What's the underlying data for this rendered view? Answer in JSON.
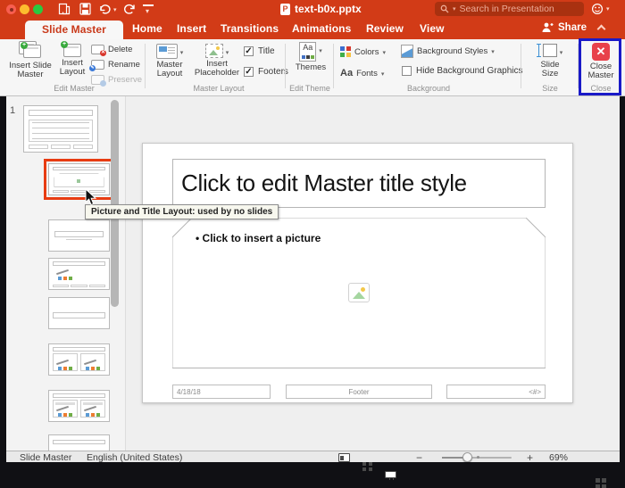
{
  "titlebar": {
    "title": "text-b0x.pptx",
    "search_placeholder": "Search in Presentation"
  },
  "tabs": {
    "items": [
      {
        "label": "Slide Master"
      },
      {
        "label": "Home"
      },
      {
        "label": "Insert"
      },
      {
        "label": "Transitions"
      },
      {
        "label": "Animations"
      },
      {
        "label": "Review"
      },
      {
        "label": "View"
      }
    ],
    "share_label": "Share"
  },
  "ribbon": {
    "insert_slide_master": "Insert Slide Master",
    "insert_layout": "Insert Layout",
    "delete": "Delete",
    "rename": "Rename",
    "preserve": "Preserve",
    "group_edit_master": "Edit Master",
    "master_layout": "Master Layout",
    "insert_placeholder": "Insert Placeholder",
    "title_checkbox": "Title",
    "footers_checkbox": "Footers",
    "checkmark": "✓",
    "group_master_layout": "Master Layout",
    "themes": "Themes",
    "group_edit_theme": "Edit Theme",
    "colors": "Colors",
    "fonts": "Fonts",
    "fonts_aa": "Aa",
    "themes_aa": "Aa",
    "background_styles": "Background Styles",
    "hide_background_graphics": "Hide Background Graphics",
    "group_background": "Background",
    "slide_size": "Slide Size",
    "group_size": "Size",
    "close_master": "Close Master",
    "close_x": "✕",
    "group_close": "Close",
    "highlight_color": "#1a1ac8"
  },
  "sidebar": {
    "index": "1",
    "tooltip": "Picture and Title Layout: used by no slides",
    "selected_border_color": "#e83c12",
    "thumbnails": [
      {
        "kind": "master",
        "name": "master-slide-thumbnail",
        "selected": false
      },
      {
        "kind": "picture",
        "name": "picture-and-title-layout-thumbnail",
        "selected": true
      },
      {
        "kind": "title",
        "name": "title-slide-layout-thumbnail",
        "selected": false
      },
      {
        "kind": "content",
        "name": "title-and-content-layout-thumbnail",
        "selected": false
      },
      {
        "kind": "section",
        "name": "section-header-layout-thumbnail",
        "selected": false
      },
      {
        "kind": "two",
        "name": "two-content-layout-thumbnail",
        "selected": false
      },
      {
        "kind": "compare",
        "name": "comparison-layout-thumbnail",
        "selected": false
      },
      {
        "kind": "titleonly",
        "name": "title-only-layout-thumbnail",
        "selected": false
      }
    ]
  },
  "slide": {
    "title_placeholder": "Click to edit Master title style",
    "picture_bullet": "•",
    "picture_placeholder": "Click to insert a picture",
    "date": "4/18/18",
    "footer": "Footer",
    "slide_number": "<#>"
  },
  "statusbar": {
    "view_name": "Slide Master",
    "language": "English (United States)",
    "zoom_minus": "−",
    "zoom_plus": "+",
    "zoom_level": "69%"
  }
}
